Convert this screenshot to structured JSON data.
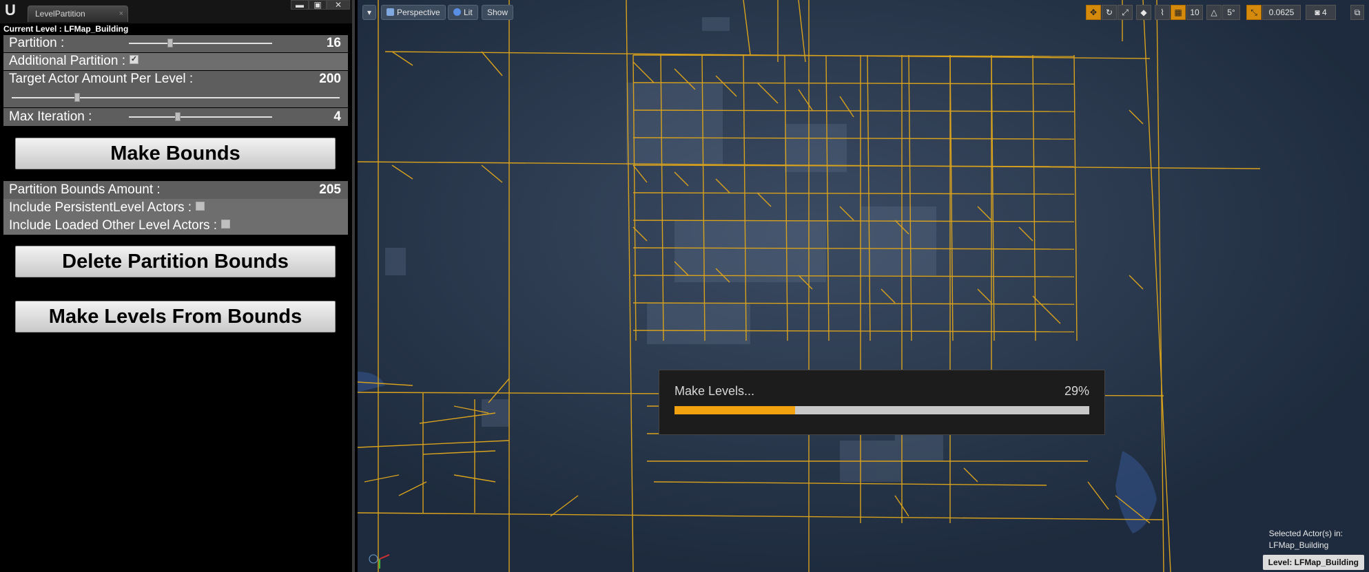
{
  "window": {
    "tab_title": "LevelPartition",
    "tab_close": "×",
    "current_level": "Current Level : LFMap_Building",
    "min_btn": "▬",
    "max_btn": "▣",
    "close_btn": "✕"
  },
  "panel": {
    "partition": {
      "label": "Partition :",
      "value": "16",
      "slider_fraction": 0.29
    },
    "additional_partition": {
      "label": "Additional Partition :",
      "checked": true,
      "check_glyph": "✓"
    },
    "target_actor": {
      "label": "Target Actor Amount Per Level :",
      "value": "200",
      "slider_fraction": 0.2
    },
    "max_iteration": {
      "label": "Max Iteration :",
      "value": "4",
      "slider_fraction": 0.34
    },
    "make_bounds_label": "Make Bounds",
    "bounds_amount": {
      "label": "Partition Bounds Amount :",
      "value": "205"
    },
    "include_persistent": {
      "label": "Include PersistentLevel Actors :",
      "checked": false
    },
    "include_loaded": {
      "label": "Include Loaded Other Level Actors :",
      "checked": false
    },
    "delete_bounds_label": "Delete Partition Bounds",
    "make_levels_label": "Make Levels From Bounds"
  },
  "viewport": {
    "dropdown_glyph": "▾",
    "perspective_label": "Perspective",
    "lit_label": "Lit",
    "show_label": "Show",
    "grid_snap": "10",
    "rotate_snap": "5°",
    "scale_snap": "0.0625",
    "camera_speed": "4",
    "progress_label": "Make Levels...",
    "progress_percent_text": "29%",
    "progress_fraction": 0.29,
    "selected_actors_line1": "Selected Actor(s) in:",
    "selected_actors_line2": "LFMap_Building",
    "level_badge": "Level:  LFMap_Building",
    "colors": {
      "grid_line": "#d9a21c",
      "ground": "#243349",
      "accent": "#f2a20e"
    }
  }
}
